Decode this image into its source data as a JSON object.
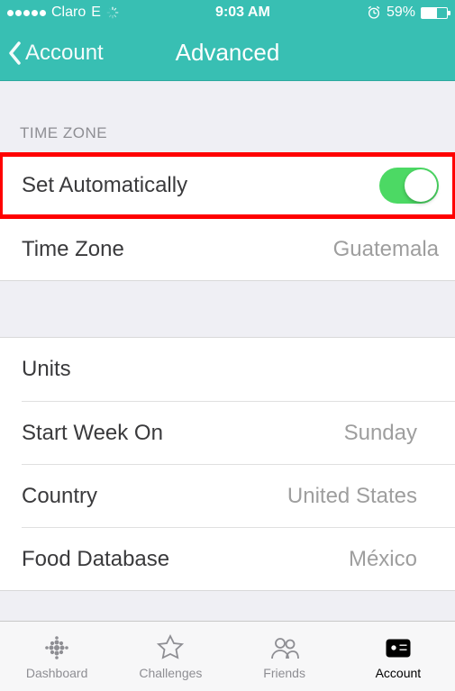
{
  "status": {
    "carrier": "Claro",
    "network": "E",
    "time": "9:03 AM",
    "battery_pct": "59%",
    "battery_level": 59
  },
  "nav": {
    "back_label": "Account",
    "title": "Advanced"
  },
  "sections": {
    "timezone": {
      "header": "TIME ZONE",
      "set_auto_label": "Set Automatically",
      "set_auto_on": true,
      "tz_label": "Time Zone",
      "tz_value": "Guatemala"
    },
    "general": {
      "units_label": "Units",
      "start_week_label": "Start Week On",
      "start_week_value": "Sunday",
      "country_label": "Country",
      "country_value": "United States",
      "food_db_label": "Food Database",
      "food_db_value": "México"
    }
  },
  "tabs": {
    "dashboard": "Dashboard",
    "challenges": "Challenges",
    "friends": "Friends",
    "account": "Account"
  }
}
